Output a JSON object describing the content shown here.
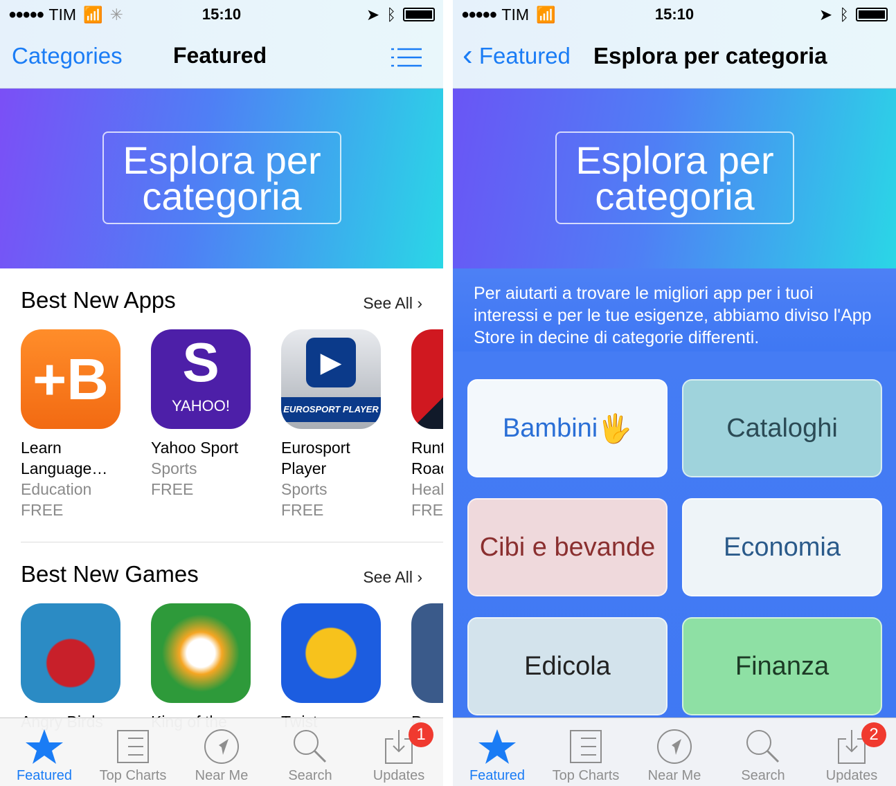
{
  "left": {
    "status": {
      "carrier": "TIM",
      "time": "15:10"
    },
    "nav": {
      "back": "Categories",
      "title": "Featured"
    },
    "banner": {
      "line1": "Esplora per",
      "line2": "categoria"
    },
    "sections": [
      {
        "title": "Best New Apps",
        "see_all": "See All",
        "apps": [
          {
            "name1": "Learn",
            "name2": "Language…",
            "category": "Education",
            "price": "FREE",
            "color": "#f57d1f",
            "glyph": "+B"
          },
          {
            "name1": "Yahoo Sport",
            "name2": "",
            "category": "Sports",
            "price": "FREE",
            "color": "#4b1ea6",
            "glyph": "YAHOO!"
          },
          {
            "name1": "Eurosport",
            "name2": "Player",
            "category": "Sports",
            "price": "FREE",
            "color": "#c8ccd2",
            "glyph": "EUROSPORT PLAYER"
          },
          {
            "name1": "Runt",
            "name2": "Road",
            "category": "Heal",
            "price": "FRE",
            "color": "#b1121a",
            "glyph": ""
          }
        ]
      },
      {
        "title": "Best New Games",
        "see_all": "See All",
        "apps": [
          {
            "name1": "Angry Birds",
            "color": "#2b8bc4"
          },
          {
            "name1": "King of the",
            "color": "#2e9a3a"
          },
          {
            "name1": "Twist",
            "color": "#1c5de0"
          },
          {
            "name1": "P",
            "color": "#3a5a8a"
          }
        ]
      }
    ],
    "tabs": [
      {
        "label": "Featured",
        "icon": "star-icon"
      },
      {
        "label": "Top Charts",
        "icon": "list-icon"
      },
      {
        "label": "Near Me",
        "icon": "location-icon"
      },
      {
        "label": "Search",
        "icon": "search-icon"
      },
      {
        "label": "Updates",
        "icon": "download-icon",
        "badge": "1"
      }
    ]
  },
  "right": {
    "status": {
      "carrier": "TIM",
      "time": "15:10"
    },
    "nav": {
      "back": "Featured",
      "title": "Esplora per categoria"
    },
    "banner": {
      "line1": "Esplora per",
      "line2": "categoria"
    },
    "description": "Per aiutarti a trovare le migliori app per i tuoi interessi e per le tue esigenze, abbiamo diviso l'App Store in decine di categorie differenti.",
    "categories": [
      {
        "label": "Bambini",
        "bg": "#f3f8fc",
        "color": "#2a6fd6"
      },
      {
        "label": "Cataloghi",
        "bg": "#9fd3dc",
        "color": "#2b4a55"
      },
      {
        "label": "Cibi e bevande",
        "bg": "#efd9dc",
        "color": "#8a2f2f"
      },
      {
        "label": "Economia",
        "bg": "#eef4f8",
        "color": "#2a5a8a"
      },
      {
        "label": "Edicola",
        "bg": "#d3e3ec",
        "color": "#222222"
      },
      {
        "label": "Finanza",
        "bg": "#8ee0a4",
        "color": "#1c3a25"
      }
    ],
    "tabs": [
      {
        "label": "Featured",
        "icon": "star-icon"
      },
      {
        "label": "Top Charts",
        "icon": "list-icon"
      },
      {
        "label": "Near Me",
        "icon": "location-icon"
      },
      {
        "label": "Search",
        "icon": "search-icon"
      },
      {
        "label": "Updates",
        "icon": "download-icon",
        "badge": "2"
      }
    ]
  }
}
